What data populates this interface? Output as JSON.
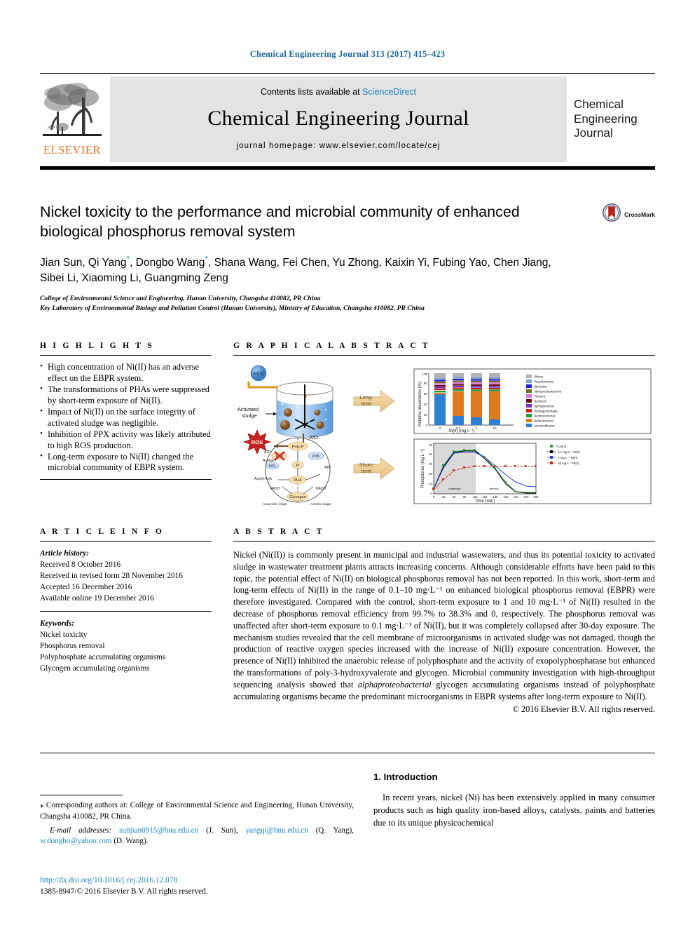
{
  "running_head": "Chemical Engineering Journal 313 (2017) 415–423",
  "masthead": {
    "contents_prefix": "Contents lists available at ",
    "sciencedirect": "ScienceDirect",
    "journal_title": "Chemical Engineering Journal",
    "homepage": "journal homepage: www.elsevier.com/locate/cej",
    "publisher": "ELSEVIER",
    "cover_line1": "Chemical",
    "cover_line2": "Engineering",
    "cover_line3": "Journal",
    "tree_logo": "elsevier-tree-icon"
  },
  "article": {
    "title": "Nickel toxicity to the performance and microbial community of enhanced biological phosphorus removal system",
    "crossmark_label": "CrossMark",
    "authors_line1": "Jian Sun, Qi Yang",
    "authors_line1b": ", Dongbo Wang",
    "authors_line1c": ", Shana Wang, Fei Chen, Yu Zhong, Kaixin Yi, Fubing Yao, Chen Jiang,",
    "authors_line2": "Sibei Li, Xiaoming Li, Guangming Zeng",
    "affiliation1": "College of Environmental Science and Engineering, Hunan University, Changsha 410082, PR China",
    "affiliation2": "Key Laboratory of Environmental Biology and Pollution Control (Hunan University), Ministry of Education, Changsha 410082, PR China"
  },
  "highlights": {
    "heading": "H I G H L I G H T S",
    "items": [
      "High concentration of Ni(II) has an adverse effect on the EBPR system.",
      "The transformations of PHAs were suppressed by short-term exposure of Ni(II).",
      "Impact of Ni(II) on the surface integrity of activated sludge was negligible.",
      "Inhibition of PPX activity was likely attributed to high ROS production.",
      "Long-term exposure to Ni(II) changed the microbial community of EBPR system."
    ]
  },
  "graphical_abstract": {
    "heading": "G R A P H I C A L   A B S T R A C T",
    "labels": {
      "ni": "Ni(II)",
      "activated_sludge": "Activated sludge",
      "ros": "ROS",
      "ao": "A/O",
      "long_term": "Long-term",
      "short_term": "Short-term",
      "anaerobic_stage": "Anaerobic stage",
      "aerobic_stage": "Aerobic stage",
      "ppx": "PPX",
      "ppk": "PPK",
      "poly_p": "Poly-P",
      "atp": "ATP",
      "adp": "ADP",
      "pi": "Pi",
      "pha": "PHA",
      "acetyl": "Acetyl-CoA",
      "glycogen": "Glycogen",
      "nadh": "NADH"
    },
    "chart_top": {
      "type": "bar",
      "title": "",
      "ylabel": "Relative abundance (%)",
      "xlabel": "Ni(II) (mg·L⁻¹)",
      "categories": [
        "0",
        "0.1",
        "1",
        "10"
      ],
      "ylim": [
        0,
        100
      ],
      "yticks": [
        0,
        20,
        40,
        60,
        80,
        100
      ],
      "series": [
        {
          "name": "Others",
          "color": "#b3b3b3",
          "values": [
            22,
            18,
            17,
            18
          ]
        },
        {
          "name": "Pseudomonas",
          "color": "#7f9fd0",
          "values": [
            3,
            3,
            3,
            3
          ]
        },
        {
          "name": "Nitrospira",
          "color": "#2222cc",
          "values": [
            3,
            3,
            3,
            3
          ]
        },
        {
          "name": "Alphaproteobacteria",
          "color": "#6b6b22",
          "values": [
            2,
            2,
            2,
            2
          ]
        },
        {
          "name": "Thauera",
          "color": "#e06fd8",
          "values": [
            2,
            2,
            2,
            2
          ]
        },
        {
          "name": "Dechloris",
          "color": "#5a1010",
          "values": [
            2,
            2,
            2,
            2
          ]
        },
        {
          "name": "Sphingomonas",
          "color": "#7a2ec8",
          "values": [
            2,
            2,
            2,
            2
          ]
        },
        {
          "name": "Hydrogenophaga",
          "color": "#cc2222",
          "values": [
            2,
            2,
            2,
            2
          ]
        },
        {
          "name": "Dechloromonas",
          "color": "#1f9d3f",
          "values": [
            3,
            2,
            2,
            2
          ]
        },
        {
          "name": "Defluviicoccus",
          "color": "#e07820",
          "values": [
            3,
            47,
            50,
            54
          ]
        },
        {
          "name": "Accumulibacter",
          "color": "#2e7fd4",
          "values": [
            56,
            17,
            15,
            10
          ]
        }
      ]
    },
    "chart_bottom": {
      "type": "line",
      "ylabel": "Phosphorus (mg·L⁻¹)",
      "xlabel": "Time (min)",
      "xticks": [
        0,
        30,
        60,
        90,
        120,
        150,
        180,
        210,
        240,
        270,
        300
      ],
      "yticks": [
        0,
        10,
        20,
        30,
        40,
        50
      ],
      "series": [
        {
          "name": "Control",
          "color": "#1f9d3f",
          "x": [
            0,
            30,
            60,
            90,
            120,
            150,
            180,
            210,
            240,
            270,
            300
          ],
          "y": [
            5,
            28,
            42,
            43,
            43,
            36,
            25,
            11,
            2,
            1,
            1
          ]
        },
        {
          "name": "0.1 mg·L⁻¹ Ni(II)",
          "color": "#000000",
          "x": [
            0,
            30,
            60,
            90,
            120,
            150,
            180,
            210,
            240,
            270,
            300
          ],
          "y": [
            5,
            27,
            41,
            42,
            42,
            35,
            24,
            10,
            2,
            1,
            1
          ]
        },
        {
          "name": "1 mg·L⁻¹ Ni(II)",
          "color": "#2e3fd4",
          "x": [
            0,
            30,
            60,
            90,
            120,
            150,
            180,
            210,
            240,
            270,
            300
          ],
          "y": [
            5,
            26,
            40,
            41,
            41,
            36,
            28,
            19,
            12,
            8,
            7
          ]
        },
        {
          "name": "10 mg·L⁻¹ Ni(II)",
          "color": "#cc2222",
          "x": [
            0,
            30,
            60,
            90,
            120,
            150,
            180,
            210,
            240,
            270,
            300
          ],
          "y": [
            4,
            14,
            23,
            26,
            27,
            27,
            27,
            27,
            27,
            27,
            27
          ]
        }
      ]
    }
  },
  "article_info": {
    "heading": "A R T I C L E   I N F O",
    "history_label": "Article history:",
    "history": [
      "Received 8 October 2016",
      "Received in revised form 28 November 2016",
      "Accepted 16 December 2016",
      "Available online 19 December 2016"
    ],
    "keywords_label": "Keywords:",
    "keywords": [
      "Nickel toxicity",
      "Phosphorus removal",
      "Polyphosphate accumulating organisms",
      "Glycogen accumulating organisms"
    ]
  },
  "abstract": {
    "heading": "A B S T R A C T",
    "body": "Nickel (Ni(II)) is commonly present in municipal and industrial wastewaters, and thus its potential toxicity to activated sludge in wastewater treatment plants attracts increasing concerns. Although considerable efforts have been paid to this topic, the potential effect of Ni(II) on biological phosphorus removal has not been reported. In this work, short-term and long-term effects of Ni(II) in the range of 0.1–10 mg·L⁻¹ on enhanced biological phosphorus removal (EBPR) were therefore investigated. Compared with the control, short-term exposure to 1 and 10 mg·L⁻¹ of Ni(II) resulted in the decrease of phosphorus removal efficiency from 99.7% to 38.3% and 0, respectively. The phosphorus removal was unaffected after short-term exposure to 0.1 mg·L⁻¹ of Ni(II), but it was completely collapsed after 30-day exposure. The mechanism studies revealed that the cell membrane of microorganisms in activated sludge was not damaged, though the production of reactive oxygen species increased with the increase of Ni(II) exposure concentration. However, the presence of Ni(II) inhibited the anaerobic release of polyphosphate and the activity of exopolyphosphatase but enhanced the transformations of poly-3-hydroxyvalerate and glycogen. Microbial community investigation with high-throughput sequencing analysis showed that ",
    "body_italic": "alphaproteobacterial",
    "body_after_italic": " glycogen accumulating organisms instead of polyphosphate accumulating organisms became the predominant microorganisms in EBPR systems after long-term exposure to Ni(II).",
    "copyright": "© 2016 Elsevier B.V. All rights reserved."
  },
  "footnotes": {
    "corresponding_marker": "⁎",
    "corresponding": " Corresponding authors at: College of Environmental Science and Engineering, Hunan University, Changsha 410082, PR China.",
    "email_label": "E-mail addresses:",
    "email1": "sunjian0915@hnu.edu.cn",
    "email1_who": " (J. Sun), ",
    "email2": "yangqi@hnu.edu.cn",
    "email2_who": " (Q. Yang), ",
    "email3": "w.dongbo@yahoo.com",
    "email3_who": " (D. Wang).",
    "doi": "http://dx.doi.org/10.1016/j.cej.2016.12.078",
    "issn_line": "1385-8947/© 2016 Elsevier B.V. All rights reserved."
  },
  "introduction": {
    "heading": "1. Introduction",
    "paragraph": "In recent years, nickel (Ni) has been extensively applied in many consumer products such as high quality iron-based alloys, catalysts, paints and batteries due to its unique physicochemical"
  },
  "colors": {
    "link": "#1a85c8",
    "elsevier_orange": "#E9711C",
    "masthead_bg": "#e3e3e3"
  }
}
